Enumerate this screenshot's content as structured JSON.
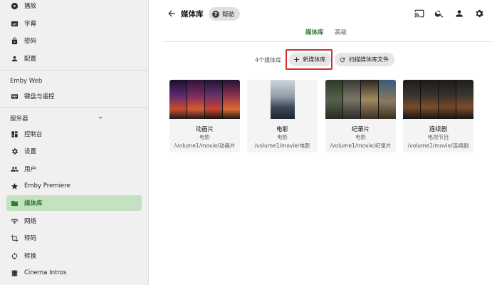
{
  "sidebar": {
    "items_top": [
      {
        "label": "播放",
        "icon": "play-circle-icon"
      },
      {
        "label": "字幕",
        "icon": "subtitles-icon"
      },
      {
        "label": "密码",
        "icon": "lock-icon"
      },
      {
        "label": "配置",
        "icon": "person-icon"
      }
    ],
    "section_emby_web": "Emby Web",
    "items_web": [
      {
        "label": "键盘与遥控",
        "icon": "keyboard-icon"
      }
    ],
    "section_server": "服务器",
    "items_server": [
      {
        "label": "控制台",
        "icon": "dashboard-icon"
      },
      {
        "label": "设置",
        "icon": "gear-icon"
      },
      {
        "label": "用户",
        "icon": "people-icon"
      },
      {
        "label": "Emby Premiere",
        "icon": "star-icon"
      },
      {
        "label": "媒体库",
        "icon": "folder-icon",
        "active": true
      },
      {
        "label": "网络",
        "icon": "wifi-icon"
      },
      {
        "label": "转码",
        "icon": "crop-icon"
      },
      {
        "label": "转换",
        "icon": "sync-icon"
      },
      {
        "label": "Cinema Intros",
        "icon": "film-icon"
      }
    ]
  },
  "header": {
    "title": "媒体库",
    "help_label": "帮助",
    "icons": [
      "cast-icon",
      "search-icon",
      "account-icon",
      "gear-icon"
    ]
  },
  "tabs": [
    {
      "label": "媒体库",
      "active": true
    },
    {
      "label": "高级",
      "active": false
    }
  ],
  "toolbar": {
    "count_text": "4个媒体库",
    "new_library_label": "新媒体库",
    "scan_label": "扫描媒体库文件"
  },
  "libraries": [
    {
      "name": "动画片",
      "type": "电影",
      "path": "/volume1/movie/动画片"
    },
    {
      "name": "电影",
      "type": "电影",
      "path": "/volume1/movie/电影"
    },
    {
      "name": "纪录片",
      "type": "电影",
      "path": "/volume1/movie/纪录片"
    },
    {
      "name": "连续剧",
      "type": "电视节目",
      "path": "/volume1/movie/连续剧"
    }
  ],
  "colors": {
    "accent": "#2e7d32",
    "active_bg": "#c4e1c2",
    "highlight_border": "#d32f2f"
  }
}
